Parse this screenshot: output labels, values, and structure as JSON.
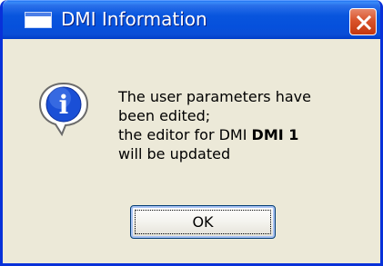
{
  "window": {
    "title": "DMI Information",
    "icon": "window-icon",
    "close_icon": "close-icon"
  },
  "message": {
    "icon": "info-icon",
    "line1": "The user parameters have",
    "line2": "been edited;",
    "line3_prefix": "the editor for DMI ",
    "line3_bold": "DMI 1",
    "line4": "will be updated"
  },
  "buttons": {
    "ok_label": "OK"
  },
  "colors": {
    "titlebar": "#0855dd",
    "frame": "#0831d9",
    "dialog_bg": "#ece9d8",
    "close_button": "#d9542b",
    "info_icon": "#1a4fd6"
  }
}
